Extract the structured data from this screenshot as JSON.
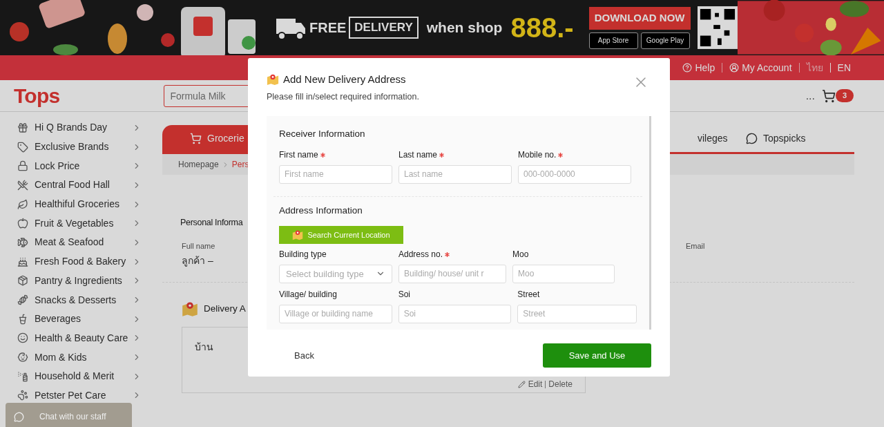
{
  "banner": {
    "free": "FREE",
    "delivery": "DELIVERY",
    "when_shop": "when shop",
    "amount": "888.-",
    "download": "DOWNLOAD NOW",
    "stores": [
      "App Store",
      "Google Play"
    ]
  },
  "top_bar": {
    "help": "Help",
    "account": "My Account",
    "languages": [
      {
        "label": "ไทย",
        "selected": false
      },
      {
        "label": "EN",
        "selected": true
      }
    ]
  },
  "header": {
    "logo": "Tops",
    "search": {
      "placeholder": "Formula Milk"
    },
    "more": "...",
    "cart_count": "3"
  },
  "sidebar": {
    "items": [
      {
        "label": "Hi Q Brands Day"
      },
      {
        "label": "Exclusive Brands"
      },
      {
        "label": "Lock Price"
      },
      {
        "label": "Central Food Hall"
      },
      {
        "label": "Healthiful Groceries"
      },
      {
        "label": "Fruit & Vegetables"
      },
      {
        "label": "Meat & Seafood"
      },
      {
        "label": "Fresh Food & Bakery"
      },
      {
        "label": "Pantry & Ingredients"
      },
      {
        "label": "Snacks & Desserts"
      },
      {
        "label": "Beverages"
      },
      {
        "label": "Health & Beauty Care"
      },
      {
        "label": "Mom & Kids"
      },
      {
        "label": "Household & Merit"
      },
      {
        "label": "Petster Pet Care"
      }
    ]
  },
  "tabs": [
    {
      "label": "Grocerie",
      "selected": true
    },
    {
      "label": "vileges",
      "selected": false
    },
    {
      "label": "Topspicks",
      "selected": false
    }
  ],
  "breadcrumb": [
    {
      "label": "Homepage",
      "current": false
    },
    {
      "label": "Pers",
      "current": true
    }
  ],
  "personal": {
    "title": "Personal Informa",
    "full_name_label": "Full name",
    "full_name": "ลูกค้า –",
    "email_label": "Email"
  },
  "delivery": {
    "title": "Delivery A",
    "address": {
      "name": "บ้าน",
      "edit": "Edit",
      "delete": "Delete"
    }
  },
  "chat": "Chat with our staff",
  "modal": {
    "title": "Add New Delivery Address",
    "subtitle": "Please fill in/select required information.",
    "sections": [
      {
        "title": "Receiver Information",
        "rows": [
          [
            {
              "label": "First name",
              "required": true,
              "kind": "text",
              "placeholder": "First name"
            },
            {
              "label": "Last name",
              "required": true,
              "kind": "text",
              "placeholder": "Last name"
            },
            {
              "label": "Mobile no.",
              "required": true,
              "kind": "text",
              "placeholder": "000-000-0000"
            }
          ]
        ]
      },
      {
        "title": "Address Information",
        "location_button": "Search Current Location",
        "rows": [
          [
            {
              "label": "Building type",
              "required": false,
              "kind": "select",
              "placeholder": "Select building type"
            },
            {
              "label": "Address no.",
              "required": true,
              "kind": "text",
              "placeholder": "Building/ house/ unit r"
            },
            {
              "label": "Moo",
              "required": false,
              "kind": "text",
              "placeholder": "Moo"
            }
          ],
          [
            {
              "label": "Village/ building",
              "required": false,
              "kind": "text",
              "placeholder": "Village or building name"
            },
            {
              "label": "Soi",
              "required": false,
              "kind": "text",
              "placeholder": "Soi"
            },
            {
              "label": "Street",
              "required": false,
              "kind": "text",
              "placeholder": "Street"
            }
          ]
        ]
      }
    ],
    "back": "Back",
    "save": "Save and Use"
  }
}
